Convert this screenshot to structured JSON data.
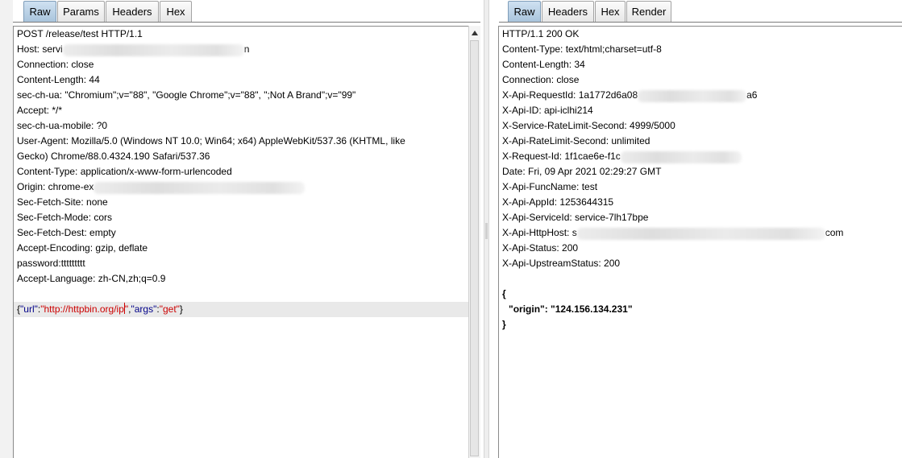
{
  "request": {
    "tabs": [
      "Raw",
      "Params",
      "Headers",
      "Hex"
    ],
    "active_tab": "Raw",
    "lines": [
      "POST /release/test HTTP/1.1",
      "Host: servi",
      "n",
      "Connection: close",
      "Content-Length: 44",
      "sec-ch-ua: \"Chromium\";v=\"88\", \"Google Chrome\";v=\"88\", \";Not A Brand\";v=\"99\"",
      "Accept: */*",
      "sec-ch-ua-mobile: ?0",
      "User-Agent: Mozilla/5.0 (Windows NT 10.0; Win64; x64) AppleWebKit/537.36 (KHTML, like",
      "Gecko) Chrome/88.0.4324.190 Safari/537.36",
      "Content-Type: application/x-www-form-urlencoded",
      "Origin: chrome-ex",
      "Sec-Fetch-Site: none",
      "Sec-Fetch-Mode: cors",
      "Sec-Fetch-Dest: empty",
      "Accept-Encoding: gzip, deflate",
      "password:ttttttttt",
      "Accept-Language: zh-CN,zh;q=0.9"
    ],
    "body": {
      "open": "{",
      "key1": "\"url\"",
      "colon": ":",
      "val1a": "\"http://httpbin.org/ip",
      "val1b": "\"",
      "comma": ",",
      "key2": "\"args\"",
      "val2": "\"get\"",
      "close": "}"
    }
  },
  "response": {
    "tabs": [
      "Raw",
      "Headers",
      "Hex",
      "Render"
    ],
    "active_tab": "Raw",
    "lines": [
      "HTTP/1.1 200 OK",
      "Content-Type: text/html;charset=utf-8",
      "Content-Length: 34",
      "Connection: close",
      "X-Api-RequestId: 1a1772d6a08",
      "a6",
      "X-Api-ID: api-iclhi214",
      "X-Service-RateLimit-Second: 4999/5000",
      "X-Api-RateLimit-Second: unlimited",
      "X-Request-Id: 1f1cae6e-f1c",
      "Date: Fri, 09 Apr 2021 02:29:27 GMT",
      "X-Api-FuncName: test",
      "X-Api-AppId: 1253644315",
      "X-Api-ServiceId: service-7lh17bpe",
      "X-Api-HttpHost: s",
      "com",
      "X-Api-Status: 200",
      "X-Api-UpstreamStatus: 200"
    ],
    "json": {
      "open": "{",
      "line": "\"origin\": \"124.156.134.231\"",
      "close": "}"
    }
  }
}
